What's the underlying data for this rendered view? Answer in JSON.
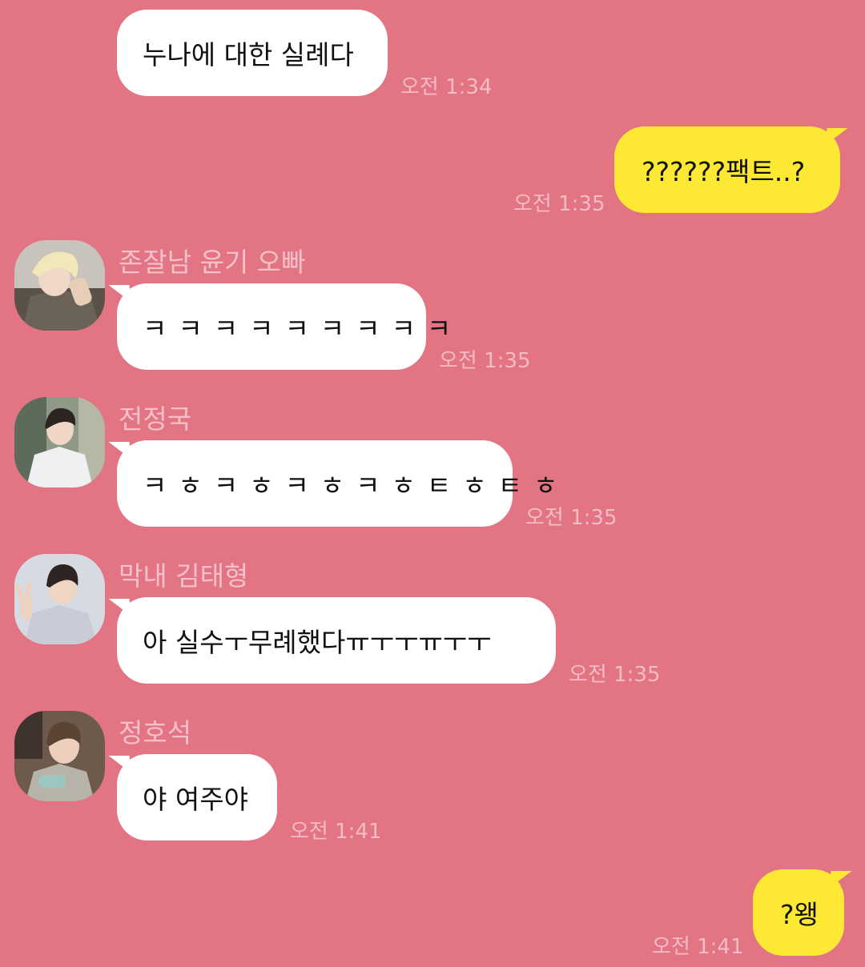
{
  "messages": [
    {
      "text": "누나에 대한 실례다",
      "time": "오전 1:34"
    },
    {
      "text": "??????팩트..?",
      "time": "오전 1:35"
    },
    {
      "sender": "존잘남 윤기 오빠",
      "avatar": "avatar-yoongi",
      "text": "ㅋㅋㅋㅋㅋㅋㅋㅋㅋ",
      "time": "오전 1:35"
    },
    {
      "sender": "전정국",
      "avatar": "avatar-jungkook",
      "text": "ㅋㅎㅋㅎㅋㅎㅋㅎㅌㅎㅌㅎ",
      "time": "오전 1:35"
    },
    {
      "sender": "막내 김태형",
      "avatar": "avatar-taehyung",
      "text": "아 실수ㅜ무례했다ㅠㅜㅜㅠㅜㅜ",
      "time": "오전 1:35"
    },
    {
      "sender": "정호석",
      "avatar": "avatar-hoseok",
      "text": "야 여주야",
      "time": "오전 1:41"
    },
    {
      "text": "?왱",
      "time": "오전 1:41"
    }
  ],
  "colors": {
    "background": "#e27484",
    "incoming_bubble": "#ffffff",
    "outgoing_bubble": "#fde933",
    "meta_text": "#f4bcc4"
  }
}
